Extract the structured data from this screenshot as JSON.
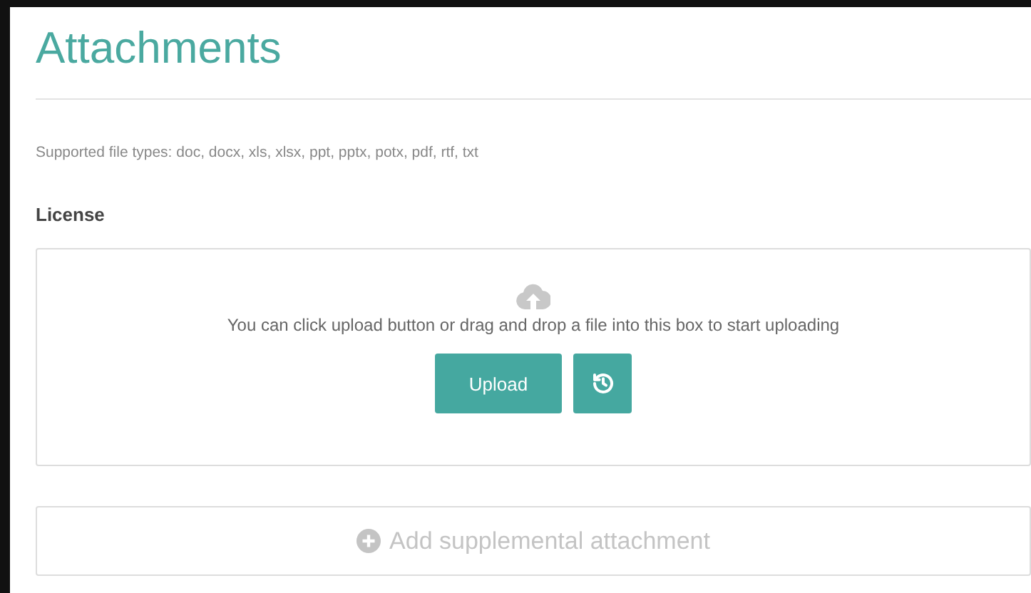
{
  "title": "Attachments",
  "supported_types": "Supported file types: doc, docx, xls, xlsx, ppt, pptx, potx, pdf, rtf, txt",
  "section_label": "License",
  "dropzone": {
    "hint": "You can click upload button or drag and drop a file into this box to start uploading",
    "upload_button": "Upload"
  },
  "add_button": {
    "label": "Add supplemental attachment",
    "disabled": true
  }
}
